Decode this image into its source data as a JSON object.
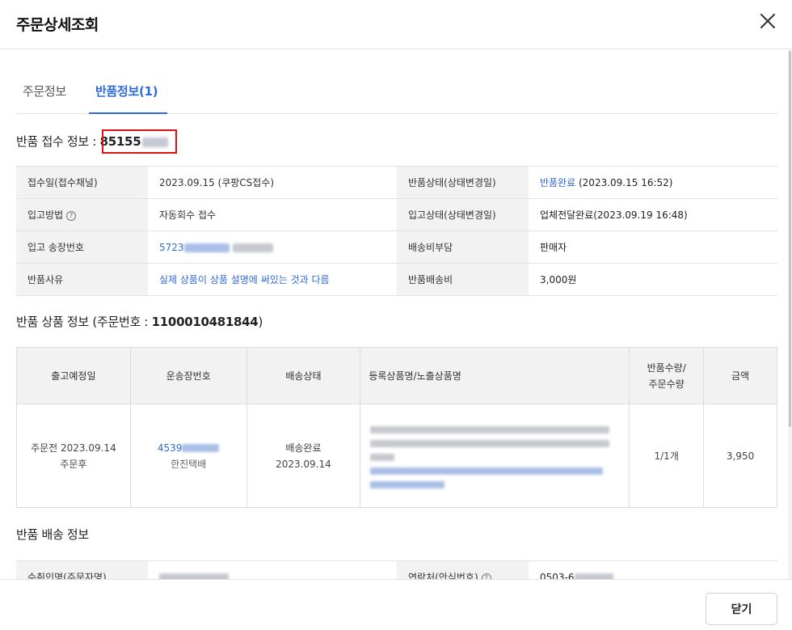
{
  "modal": {
    "title": "주문상세조회",
    "close_label": "닫기"
  },
  "tabs": [
    {
      "label": "주문정보"
    },
    {
      "label": "반품정보(1)"
    }
  ],
  "return_receipt": {
    "title": "반품 접수 정보 : ",
    "number_visible": "85155",
    "rows": [
      {
        "label": "접수일(접수채널)",
        "value": "2023.09.15 (쿠팡CS접수)",
        "label2": "반품상태(상태변경일)",
        "value2_link": "반품완료",
        "value2_rest": " (2023.09.15 16:52)"
      },
      {
        "label": "입고방법",
        "help_icon": "?",
        "value": "자동회수 접수",
        "label2": "입고상태(상태변경일)",
        "value2_rest": "업체전달완료(2023.09.19 16:48)"
      },
      {
        "label": "입고 송장번호",
        "value_link": "5723",
        "label2": "배송비부담",
        "value2_rest": "판매자"
      },
      {
        "label": "반품사유",
        "value_link": "실제 상품이 상품 설명에 써있는 것과 다름",
        "label2": "반품배송비",
        "value2_rest": "3,000원"
      }
    ]
  },
  "return_items": {
    "title_prefix": "반품 상품 정보 (주문번호 : ",
    "order_number": "1100010481844",
    "title_suffix": ")",
    "headers": [
      "출고예정일",
      "운송장번호",
      "배송상태",
      "등록상품명/노출상품명",
      "반품수량/",
      "주문수량",
      "금액"
    ],
    "row": {
      "ship_line1": "주문전 2023.09.14",
      "ship_line2": "주문후",
      "invoice_visible": "4539",
      "carrier": "한진택배",
      "status": "배송완료",
      "status_date": "2023.09.14",
      "quantity": "1/1개",
      "amount": "3,950"
    }
  },
  "return_shipping": {
    "title": "반품 배송 정보",
    "receiver_label": "수취인명(주문자명)",
    "contact_label": "연락처(안심번호)",
    "contact_visible": "0503-6"
  }
}
